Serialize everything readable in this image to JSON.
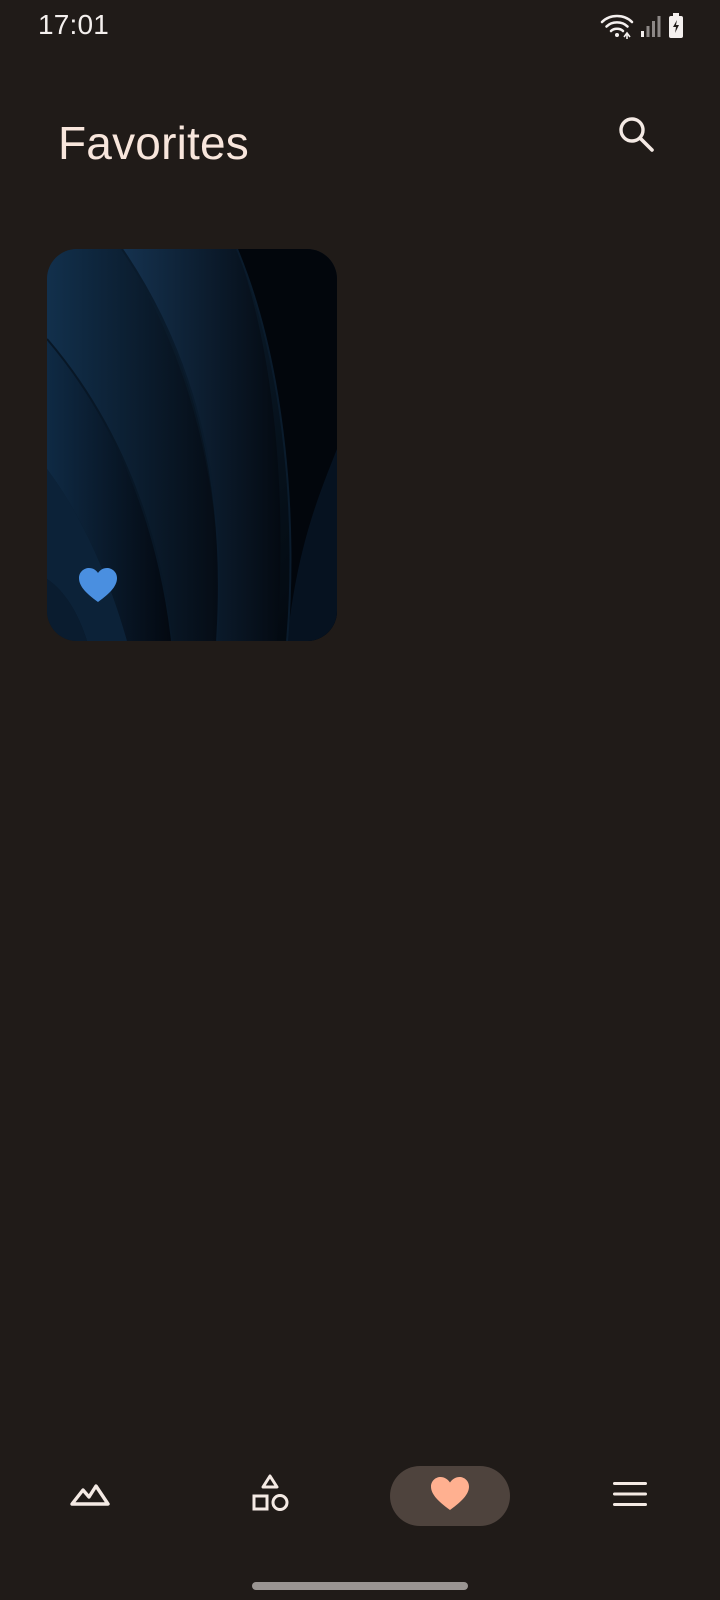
{
  "status_bar": {
    "time": "17:01",
    "icons": [
      "wifi-icon",
      "signal-icon",
      "battery-charging-icon"
    ]
  },
  "header": {
    "title": "Favorites",
    "search_icon": "search-icon"
  },
  "favorites": [
    {
      "name": "dark-blue-wallpaper",
      "favorited": true,
      "heart_color": "#4a8fe0"
    }
  ],
  "bottom_nav": {
    "items": [
      {
        "id": "wallpapers",
        "icon": "mountains-icon",
        "active": false
      },
      {
        "id": "shapes",
        "icon": "shapes-icon",
        "active": false
      },
      {
        "id": "favorites",
        "icon": "heart-icon",
        "active": true
      },
      {
        "id": "menu",
        "icon": "menu-icon",
        "active": false
      }
    ]
  },
  "colors": {
    "background": "#201b18",
    "title": "#f8e6dc",
    "accent": "#ffb090",
    "active_pill": "#4e433d",
    "favorite_heart": "#4a8fe0"
  }
}
